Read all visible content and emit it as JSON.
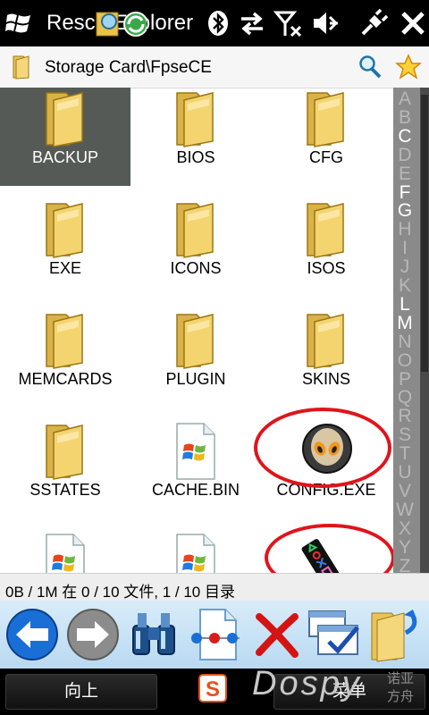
{
  "status_bar": {
    "title": "Resco Explorer",
    "icons": [
      "windows-start-icon",
      "resco-explorer-app-icon",
      "bluetooth-icon",
      "sync-arrows-icon",
      "signal-off-icon",
      "volume-mute-icon",
      "power-plug-icon",
      "close-icon"
    ]
  },
  "path_bar": {
    "path": "Storage Card\\FpseCE",
    "icons": [
      "folder-icon",
      "search-icon",
      "favorite-star-icon"
    ]
  },
  "files": [
    {
      "name": "BACKUP",
      "type": "folder",
      "selected": true
    },
    {
      "name": "BIOS",
      "type": "folder"
    },
    {
      "name": "CFG",
      "type": "folder"
    },
    {
      "name": "EXE",
      "type": "folder"
    },
    {
      "name": "ICONS",
      "type": "folder"
    },
    {
      "name": "ISOS",
      "type": "folder"
    },
    {
      "name": "MEMCARDS",
      "type": "folder"
    },
    {
      "name": "PLUGIN",
      "type": "folder"
    },
    {
      "name": "SKINS",
      "type": "folder"
    },
    {
      "name": "SSTATES",
      "type": "folder"
    },
    {
      "name": "CACHE.BIN",
      "type": "file"
    },
    {
      "name": "CONFIG.EXE",
      "type": "exe",
      "icon": "alien-head-icon",
      "highlighted": true
    },
    {
      "name": "",
      "type": "file"
    },
    {
      "name": "",
      "type": "file"
    },
    {
      "name": "",
      "type": "exe",
      "icon": "playstation-controller-icon",
      "highlighted": true
    }
  ],
  "alphabet_index": [
    "A",
    "B",
    "C",
    "D",
    "E",
    "F",
    "G",
    "H",
    "I",
    "J",
    "K",
    "L",
    "M",
    "N",
    "O",
    "P",
    "Q",
    "R",
    "S",
    "T",
    "U",
    "V",
    "W",
    "X",
    "Y",
    "Z"
  ],
  "alphabet_active": [
    "C",
    "F",
    "G",
    "L",
    "M"
  ],
  "info_bar": {
    "text": "0B / 1M 在 0 / 10 文件, 1 / 10 目录"
  },
  "toolbar": {
    "icons": [
      "back-arrow-icon",
      "forward-arrow-icon",
      "binoculars-icon",
      "network-share-icon",
      "delete-x-icon",
      "window-select-icon",
      "folder-up-icon"
    ]
  },
  "soft_keys": {
    "left": "向上",
    "right": "菜单",
    "center_icon": "sogou-input-icon"
  },
  "watermark": {
    "text": "Dospy",
    "sub": "诺亚方舟"
  },
  "colors": {
    "highlight_circle": "#e0141b",
    "selected_bg": "#555a56",
    "toolbar_bg": "#c8e2f6"
  }
}
